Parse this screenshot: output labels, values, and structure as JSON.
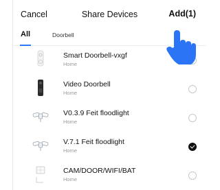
{
  "header": {
    "cancel_label": "Cancel",
    "title": "Share Devices",
    "add_label": "Add(1)"
  },
  "tabs": [
    {
      "label": "All"
    },
    {
      "label": "Doorbell"
    }
  ],
  "devices": [
    {
      "name": "Smart Doorbell-vxgf",
      "room": "Home",
      "icon": "smart-doorbell-icon",
      "selected": false
    },
    {
      "name": "Video Doorbell",
      "room": "Home",
      "icon": "video-doorbell-icon",
      "selected": false
    },
    {
      "name": "V0.3.9 Feit floodlight",
      "room": "Home",
      "icon": "floodlight-icon",
      "selected": false
    },
    {
      "name": "V.7.1 Feit floodlight",
      "room": "Home",
      "icon": "floodlight-icon",
      "selected": true
    },
    {
      "name": "CAM/DOOR/WIFI/BAT",
      "room": "Home",
      "icon": "camera-doorbell-icon",
      "selected": false
    }
  ],
  "colors": {
    "accent": "#2b79ff",
    "hand": "#2a74f5",
    "checked": "#111111"
  }
}
